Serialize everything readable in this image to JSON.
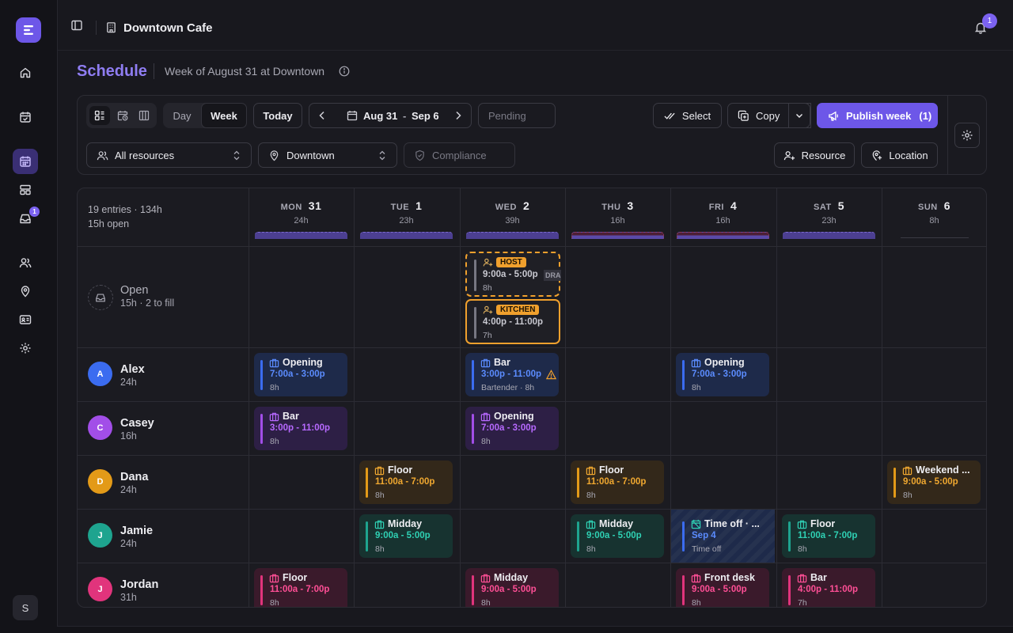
{
  "sidebar": {
    "user_initial": "S",
    "inbox_badge": "1",
    "icons": [
      "home-icon",
      "calendar-check-icon",
      "calendar-icon",
      "layout-icon",
      "inbox-icon",
      "users-icon",
      "map-pin-icon",
      "id-card-icon",
      "gear-icon"
    ]
  },
  "topbar": {
    "location_name": "Downtown Cafe",
    "notification_count": "1"
  },
  "header": {
    "title": "Schedule",
    "subtitle": "Week of August 31 at Downtown"
  },
  "toolbar": {
    "view_day": "Day",
    "view_week": "Week",
    "today": "Today",
    "date_start": "Aug 31",
    "date_sep": "-",
    "date_end": "Sep 6",
    "pending_placeholder": "Pending",
    "select": "Select",
    "copy": "Copy",
    "publish": "Publish week",
    "publish_count": "(1)",
    "resources_filter": "All resources",
    "location_filter": "Downtown",
    "compliance_placeholder": "Compliance",
    "add_resource": "Resource",
    "add_location": "Location"
  },
  "colors": {
    "accent": "#6d57e8",
    "blue": "#3b6cf0",
    "purple": "#a24ee8",
    "amber": "#e39a18",
    "teal": "#1ea48f",
    "pink": "#e1347c",
    "warning": "#f0a02d"
  },
  "summary": {
    "line1": "19 entries · 134h",
    "line2": "15h open"
  },
  "days": [
    {
      "name": "MON",
      "num": "31",
      "hours": "24h"
    },
    {
      "name": "TUE",
      "num": "1",
      "hours": "23h"
    },
    {
      "name": "WED",
      "num": "2",
      "hours": "39h"
    },
    {
      "name": "THU",
      "num": "3",
      "hours": "16h"
    },
    {
      "name": "FRI",
      "num": "4",
      "hours": "16h"
    },
    {
      "name": "SAT",
      "num": "5",
      "hours": "23h"
    },
    {
      "name": "SUN",
      "num": "6",
      "hours": "8h"
    }
  ],
  "open_row": {
    "label": "Open",
    "detail": "15h · 2 to fill",
    "shifts": [
      {
        "day": 2,
        "tag": "HOST",
        "time": "9:00a - 5:00p",
        "hours": "8h",
        "draft": "DRAFT"
      },
      {
        "day": 2,
        "tag": "KITCHEN",
        "time": "4:00p - 11:00p",
        "hours": "7h"
      }
    ]
  },
  "staff": [
    {
      "name": "Alex",
      "hours": "24h",
      "initial": "A",
      "color": "#3b6cf0",
      "shifts": [
        {
          "day": 0,
          "title": "Opening",
          "time": "7:00a - 3:00p",
          "meta": "8h"
        },
        {
          "day": 2,
          "title": "Bar",
          "time": "3:00p - 11:00p",
          "meta": "Bartender · 8h",
          "warning": true
        },
        {
          "day": 4,
          "title": "Opening",
          "time": "7:00a - 3:00p",
          "meta": "8h"
        }
      ]
    },
    {
      "name": "Casey",
      "hours": "16h",
      "initial": "C",
      "color": "#a24ee8",
      "shifts": [
        {
          "day": 0,
          "title": "Bar",
          "time": "3:00p - 11:00p",
          "meta": "8h"
        },
        {
          "day": 2,
          "title": "Opening",
          "time": "7:00a - 3:00p",
          "meta": "8h"
        }
      ]
    },
    {
      "name": "Dana",
      "hours": "24h",
      "initial": "D",
      "color": "#e39a18",
      "shifts": [
        {
          "day": 1,
          "title": "Floor",
          "time": "11:00a - 7:00p",
          "meta": "8h"
        },
        {
          "day": 3,
          "title": "Floor",
          "time": "11:00a - 7:00p",
          "meta": "8h"
        },
        {
          "day": 6,
          "title": "Weekend ...",
          "time": "9:00a - 5:00p",
          "meta": "8h"
        }
      ]
    },
    {
      "name": "Jamie",
      "hours": "24h",
      "initial": "J",
      "color": "#1ea48f",
      "shifts": [
        {
          "day": 1,
          "title": "Midday",
          "time": "9:00a - 5:00p",
          "meta": "8h"
        },
        {
          "day": 3,
          "title": "Midday",
          "time": "9:00a - 5:00p",
          "meta": "8h"
        },
        {
          "day": 4,
          "title": "Time off · ...",
          "time": "Sep 4",
          "meta": "Time off",
          "timeoff": true
        },
        {
          "day": 5,
          "title": "Floor",
          "time": "11:00a - 7:00p",
          "meta": "8h"
        }
      ]
    },
    {
      "name": "Jordan",
      "hours": "31h",
      "initial": "J",
      "color": "#e1347c",
      "shifts": [
        {
          "day": 0,
          "title": "Floor",
          "time": "11:00a - 7:00p",
          "meta": "8h"
        },
        {
          "day": 2,
          "title": "Midday",
          "time": "9:00a - 5:00p",
          "meta": "8h"
        },
        {
          "day": 4,
          "title": "Front desk",
          "time": "9:00a - 5:00p",
          "meta": "8h"
        },
        {
          "day": 5,
          "title": "Bar",
          "time": "4:00p - 11:00p",
          "meta": "7h"
        }
      ]
    }
  ]
}
